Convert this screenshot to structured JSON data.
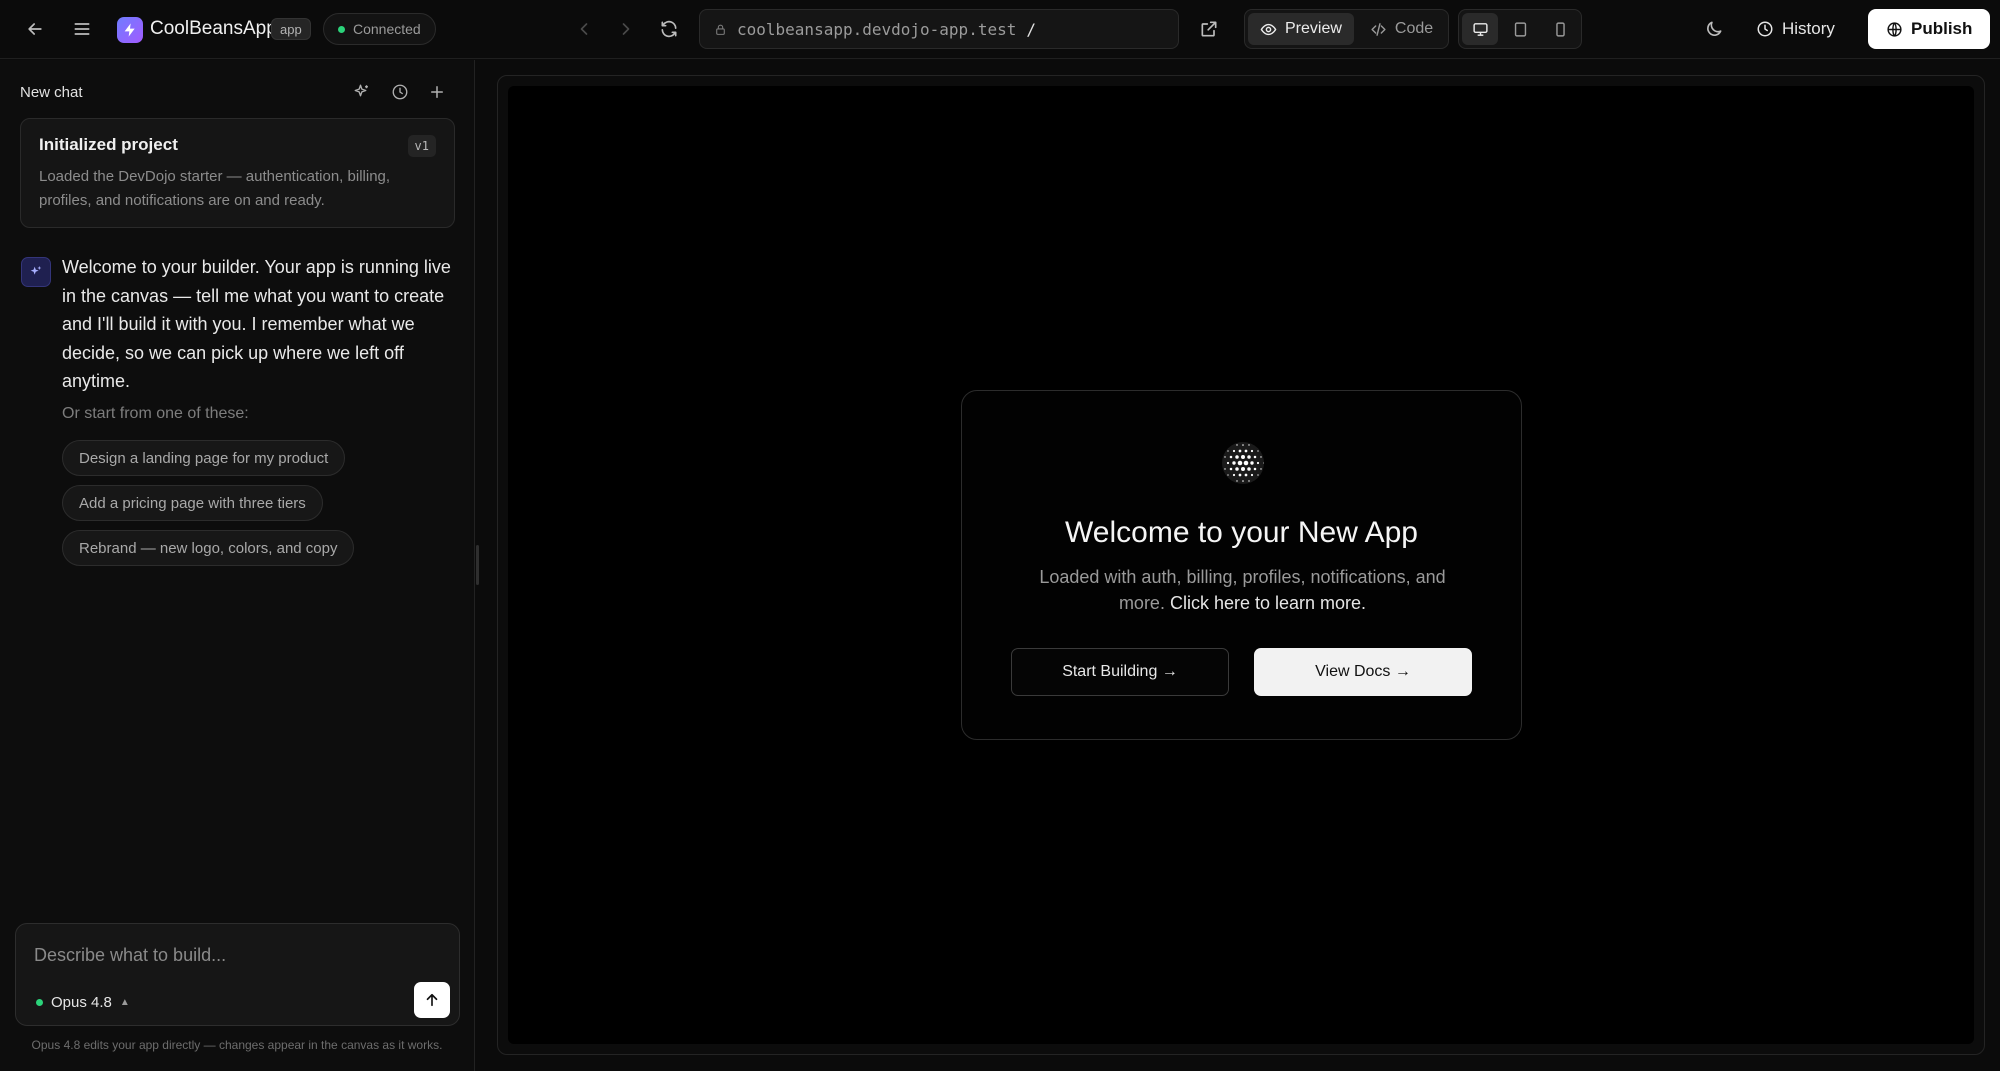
{
  "header": {
    "app_name": "CoolBeansApp",
    "app_badge": "app",
    "status": "Connected",
    "url_host": "coolbeansapp.devdojo-app.test",
    "url_path": "/",
    "view_preview": "Preview",
    "view_code": "Code",
    "history": "History",
    "publish": "Publish"
  },
  "sidebar": {
    "chat_title": "New chat",
    "init_card": {
      "title": "Initialized project",
      "version": "v1",
      "description": "Loaded the DevDojo starter — authentication, billing, profiles, and notifications are on and ready."
    },
    "assistant_message": "Welcome to your builder. Your app is running live in the canvas — tell me what you want to create and I'll build it with you. I remember what we decide, so we can pick up where we left off anytime.",
    "start_hint": "Or start from one of these:",
    "suggestions": [
      "Design a landing page for my product",
      "Add a pricing page with three tiers",
      "Rebrand — new logo, colors, and copy"
    ],
    "composer": {
      "placeholder": "Describe what to build...",
      "model": "Opus 4.8"
    },
    "footnote": "Opus 4.8 edits your app directly — changes appear in the canvas as it works."
  },
  "canvas": {
    "title": "Welcome to your New App",
    "subtitle": "Loaded with auth, billing, profiles, notifications, and more.",
    "learn_more": "Click here to learn more.",
    "start_button": "Start Building →",
    "docs_button": "View Docs →"
  },
  "colors": {
    "accent_gradient_start": "#6f7dff",
    "accent_gradient_end": "#a25bff",
    "status_green": "#2bd37a",
    "background": "#0b0b0b"
  }
}
